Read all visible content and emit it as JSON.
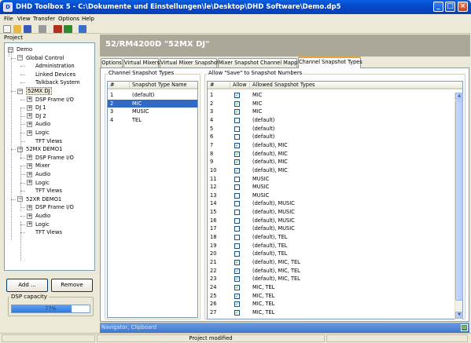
{
  "window": {
    "app_icon": "D",
    "title": "DHD Toolbox 5 - C:\\Dokumente und Einstellungen\\le\\Desktop\\DHD Software\\Demo.dp5",
    "minimize_glyph": "_",
    "maximize_glyph": "□",
    "close_glyph": "×"
  },
  "menu": [
    "File",
    "View",
    "Transfer",
    "Options",
    "Help"
  ],
  "toolbar": {
    "icons": [
      "new-file-icon",
      "open-folder-icon",
      "save-icon",
      "print-icon",
      "connect-device-icon",
      "device-settings-icon",
      "window-layout-icon"
    ],
    "colors": [
      "#f4f4f4",
      "#e8b840",
      "#3a5ab8",
      "#9a9a9a",
      "#b03020",
      "#2e8a2e",
      "#3a70c8"
    ]
  },
  "project": {
    "header": "Project",
    "tree": [
      {
        "label": "Demo",
        "level": 0,
        "expander": "−"
      },
      {
        "label": "Global Control",
        "level": 1,
        "expander": "−"
      },
      {
        "label": "Administration",
        "level": 2,
        "expander": ""
      },
      {
        "label": "Linked Devices",
        "level": 2,
        "expander": ""
      },
      {
        "label": "Talkback System",
        "level": 2,
        "expander": ""
      },
      {
        "label": "52MX DJ",
        "level": 1,
        "expander": "−",
        "selected": true
      },
      {
        "label": "DSP Frame I/O",
        "level": 2,
        "expander": "+"
      },
      {
        "label": "DJ 1",
        "level": 2,
        "expander": "+"
      },
      {
        "label": "DJ 2",
        "level": 2,
        "expander": "+"
      },
      {
        "label": "Audio",
        "level": 2,
        "expander": "+"
      },
      {
        "label": "Logic",
        "level": 2,
        "expander": "+"
      },
      {
        "label": "TFT Views",
        "level": 2,
        "expander": ""
      },
      {
        "label": "52MX DEMO1",
        "level": 1,
        "expander": "−"
      },
      {
        "label": "DSP Frame I/O",
        "level": 2,
        "expander": "+"
      },
      {
        "label": "Mixer",
        "level": 2,
        "expander": "+"
      },
      {
        "label": "Audio",
        "level": 2,
        "expander": "+"
      },
      {
        "label": "Logic",
        "level": 2,
        "expander": "+"
      },
      {
        "label": "TFT Views",
        "level": 2,
        "expander": ""
      },
      {
        "label": "52XR DEMO1",
        "level": 1,
        "expander": "−"
      },
      {
        "label": "DSP Frame I/O",
        "level": 2,
        "expander": "+"
      },
      {
        "label": "Audio",
        "level": 2,
        "expander": "+"
      },
      {
        "label": "Logic",
        "level": 2,
        "expander": "+"
      },
      {
        "label": "TFT Views",
        "level": 2,
        "expander": ""
      }
    ],
    "add_button": "Add ...",
    "remove_button": "Remove",
    "dsp_capacity_label": "DSP capacity",
    "dsp_capacity_value": 0.77,
    "dsp_capacity_text": "77%"
  },
  "main": {
    "title": "52/RM4200D \"52MX DJ\"",
    "tabs": [
      "Options",
      "Virtual Mixers",
      "Virtual Mixer Snapshots",
      "Mixer Snapshot Channel Mapping",
      "Channel Snapshot Types"
    ],
    "active_tab": 4,
    "types_group": {
      "title": "Channel Snapshot Types",
      "columns": [
        "#",
        "Snapshot Type Name"
      ],
      "rows": [
        {
          "num": "1",
          "name": "(default)",
          "selected": false
        },
        {
          "num": "2",
          "name": "MIC",
          "selected": true
        },
        {
          "num": "3",
          "name": "MUSIC",
          "selected": false
        },
        {
          "num": "4",
          "name": "TEL",
          "selected": false
        }
      ]
    },
    "allow_group": {
      "title": "Allow \"Save\" to Snapshot Numbers",
      "columns": [
        "#",
        "Allow",
        "Allowed Snapshot Types"
      ],
      "check_glyph": "✓",
      "rows": [
        {
          "num": "1",
          "allow": true,
          "types": "MIC"
        },
        {
          "num": "2",
          "allow": true,
          "types": "MIC"
        },
        {
          "num": "3",
          "allow": true,
          "types": "MIC"
        },
        {
          "num": "4",
          "allow": false,
          "types": "(default)"
        },
        {
          "num": "5",
          "allow": false,
          "types": "(default)"
        },
        {
          "num": "6",
          "allow": false,
          "types": "(default)"
        },
        {
          "num": "7",
          "allow": true,
          "types": "(default), MIC"
        },
        {
          "num": "8",
          "allow": true,
          "types": "(default), MIC"
        },
        {
          "num": "9",
          "allow": true,
          "types": "(default), MIC"
        },
        {
          "num": "10",
          "allow": true,
          "types": "(default), MIC"
        },
        {
          "num": "11",
          "allow": false,
          "types": "MUSIC"
        },
        {
          "num": "12",
          "allow": false,
          "types": "MUSIC"
        },
        {
          "num": "13",
          "allow": false,
          "types": "MUSIC"
        },
        {
          "num": "14",
          "allow": false,
          "types": "(default), MUSIC"
        },
        {
          "num": "15",
          "allow": false,
          "types": "(default), MUSIC"
        },
        {
          "num": "16",
          "allow": false,
          "types": "(default), MUSIC"
        },
        {
          "num": "17",
          "allow": false,
          "types": "(default), MUSIC"
        },
        {
          "num": "18",
          "allow": false,
          "types": "(default), TEL"
        },
        {
          "num": "19",
          "allow": false,
          "types": "(default), TEL"
        },
        {
          "num": "20",
          "allow": false,
          "types": "(default), TEL"
        },
        {
          "num": "21",
          "allow": true,
          "types": "(default), MIC, TEL"
        },
        {
          "num": "22",
          "allow": true,
          "types": "(default), MIC, TEL"
        },
        {
          "num": "23",
          "allow": true,
          "types": "(default), MIC, TEL"
        },
        {
          "num": "24",
          "allow": true,
          "types": "MIC, TEL"
        },
        {
          "num": "25",
          "allow": true,
          "types": "MIC, TEL"
        },
        {
          "num": "26",
          "allow": true,
          "types": "MIC, TEL"
        },
        {
          "num": "27",
          "allow": true,
          "types": "MIC, TEL"
        }
      ]
    },
    "scroll_up_glyph": "▲",
    "scroll_down_glyph": "▼"
  },
  "navigator": {
    "label": "Navigator, Clipboard",
    "toggle_glyph": "⊟"
  },
  "status": {
    "text": "Project modified"
  }
}
